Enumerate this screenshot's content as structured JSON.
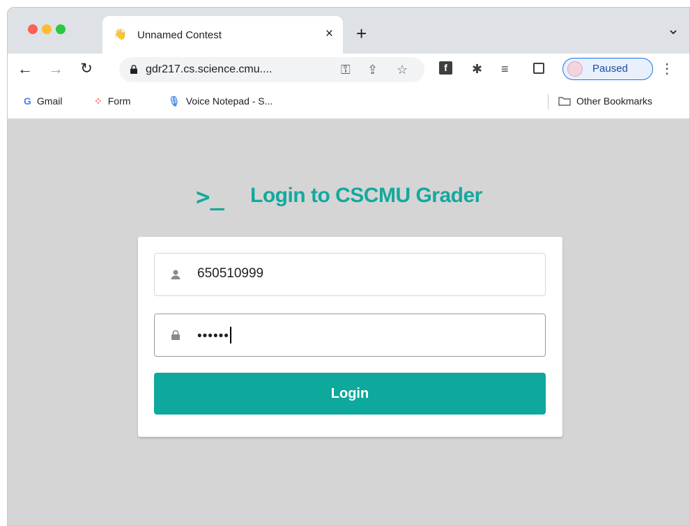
{
  "browser": {
    "tab": {
      "title": "Unnamed Contest",
      "close_glyph": "×",
      "favicon": "wave-hand-icon"
    },
    "new_tab_glyph": "+",
    "url": "gdr217.cs.science.cmu....",
    "profile_label": "Paused",
    "bookmarks": [
      {
        "label": "Gmail",
        "icon": "google-icon"
      },
      {
        "label": "Form",
        "icon": "form-icon"
      },
      {
        "label": "Voice Notepad - S...",
        "icon": "microphone-icon"
      }
    ],
    "other_bookmarks_label": "Other Bookmarks"
  },
  "page": {
    "prompt_glyph": ">_",
    "title": "Login to CSCMU Grader",
    "username_value": "650510999",
    "password_mask": "••••••",
    "login_label": "Login"
  },
  "colors": {
    "accent": "#14a89e",
    "button": "#0ea89c",
    "background": "#d5d5d5",
    "profile_border": "#1a73e8"
  }
}
